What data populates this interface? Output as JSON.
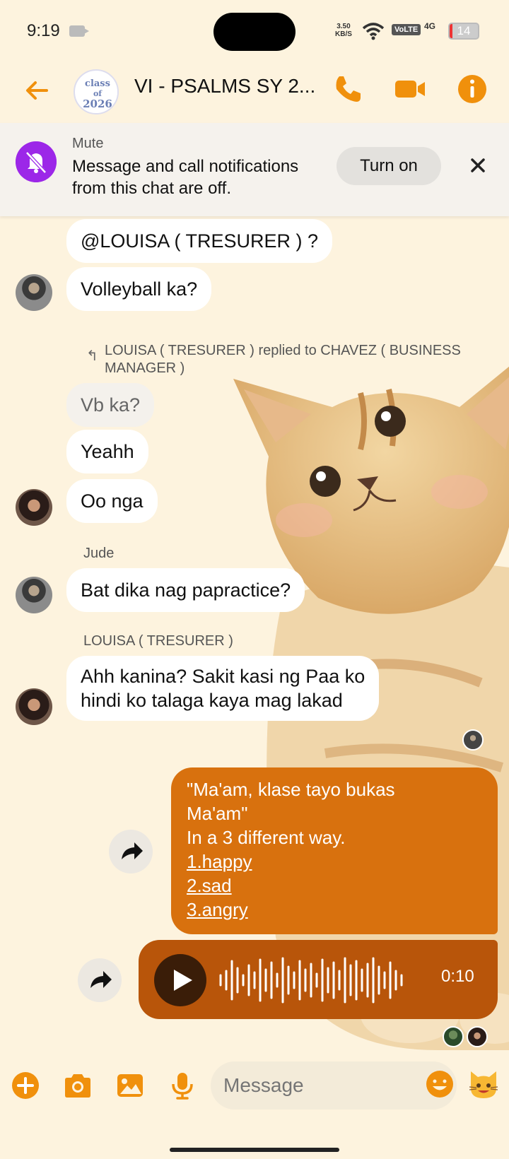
{
  "status_bar": {
    "time": "9:19",
    "net_speed_value": "3.50",
    "net_speed_unit": "KB/S",
    "volte": "VoLTE",
    "network": "4G",
    "battery": "14"
  },
  "header": {
    "title": "VI - PSALMS SY 2...",
    "avatar_text": "class of 2026",
    "accent": "#F0900C"
  },
  "mute_banner": {
    "label": "Mute",
    "text": "Message and call notifications from this chat are off.",
    "turn_on": "Turn on"
  },
  "messages": {
    "m1": "@LOUISA ( TRESURER ) ?",
    "m2": "Volleyball ka?",
    "reply_note": "LOUISA ( TRESURER ) replied to CHAVEZ ( BUSINESS MANAGER )",
    "m3": "Vb ka?",
    "m4": "Yeahh",
    "m5": "Oo nga",
    "sender_jude": "Jude",
    "m6": "Bat dika nag papractice?",
    "sender_louisa": "LOUISA ( TRESURER )",
    "m7_line1": "Ahh kanina? Sakit kasi ng Paa ko",
    "m7_line2": "hindi ko talaga kaya mag lakad",
    "outgoing_line1": "\"Ma'am, klase tayo bukas",
    "outgoing_line2": "Ma'am\"",
    "outgoing_line3": "In a 3 different way.",
    "outgoing_item1": "1.happy",
    "outgoing_item2": "2.sad",
    "outgoing_item3": "3.angry",
    "voice_duration": "0:10",
    "outgoing_color": "#D8710E",
    "voice_color": "#B8550A"
  },
  "composer": {
    "placeholder": "Message"
  }
}
